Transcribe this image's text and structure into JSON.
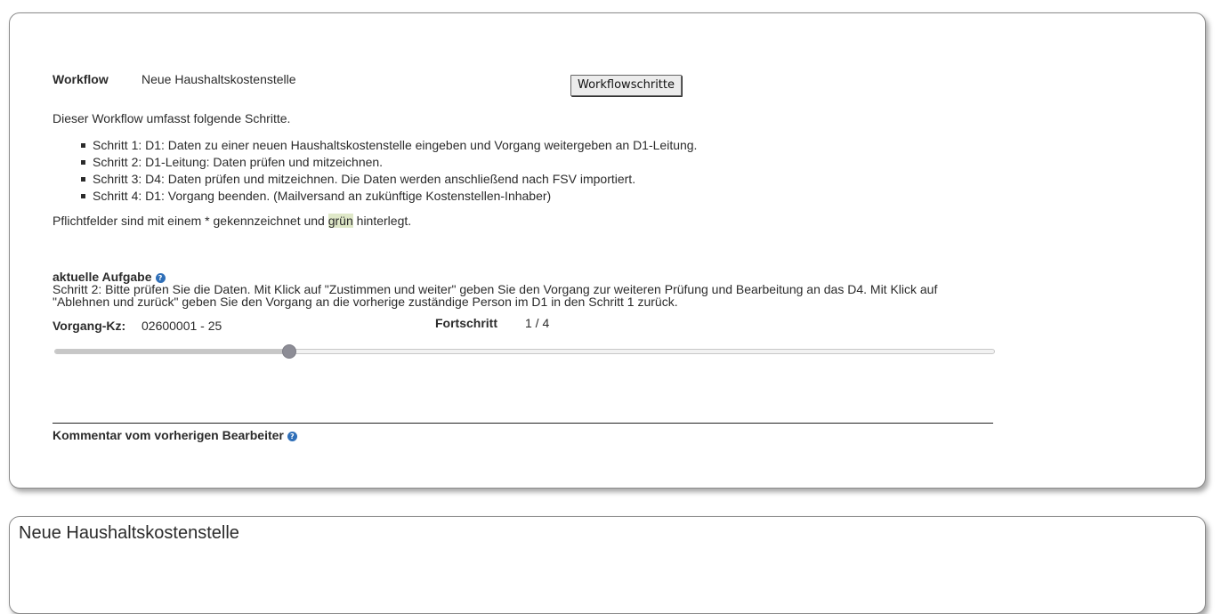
{
  "workflow": {
    "label": "Workflow",
    "name": "Neue Haushaltskostenstelle",
    "steps_button": "Workflowschritte",
    "intro": "Dieser Workflow umfasst folgende Schritte.",
    "steps": [
      "Schritt 1: D1: Daten zu einer neuen Haushaltskostenstelle eingeben und Vorgang weitergeben an D1-Leitung.",
      "Schritt 2: D1-Leitung: Daten prüfen und mitzeichnen.",
      "Schritt 3: D4: Daten prüfen und mitzeichnen. Die Daten werden anschließend nach FSV importiert.",
      "Schritt 4: D1: Vorgang beenden. (Mailversand an zukünftige Kostenstellen-Inhaber)"
    ],
    "required_note_pre": "Pflichtfelder sind mit einem * gekennzeichnet und ",
    "required_note_highlight": "grün",
    "required_note_post": " hinterlegt.",
    "highlight_color": "#dfe8c8"
  },
  "task": {
    "label": "aktuelle Aufgabe",
    "help_icon": "help-icon",
    "text": "Schritt 2: Bitte prüfen Sie die Daten. Mit Klick auf \"Zustimmen und weiter\" geben Sie den Vorgang zur weiteren Prüfung und Bearbeitung an das D4. Mit Klick auf \"Ablehnen und zurück\" geben Sie den Vorgang an die vorherige zuständige Person im D1 in den Schritt 1 zurück."
  },
  "process": {
    "id_label": "Vorgang-Kz:",
    "id_value": "02600001 - 25",
    "progress_label": "Fortschritt",
    "progress_value": "1 / 4",
    "progress_fraction": 0.25
  },
  "comment": {
    "label": "Kommentar vom vorherigen Bearbeiter",
    "help_icon": "help-icon"
  },
  "form": {
    "title": "Neue Haushaltskostenstelle"
  },
  "colors": {
    "help_icon": "#2f6fb8",
    "slider_thumb": "#8d8d96"
  }
}
